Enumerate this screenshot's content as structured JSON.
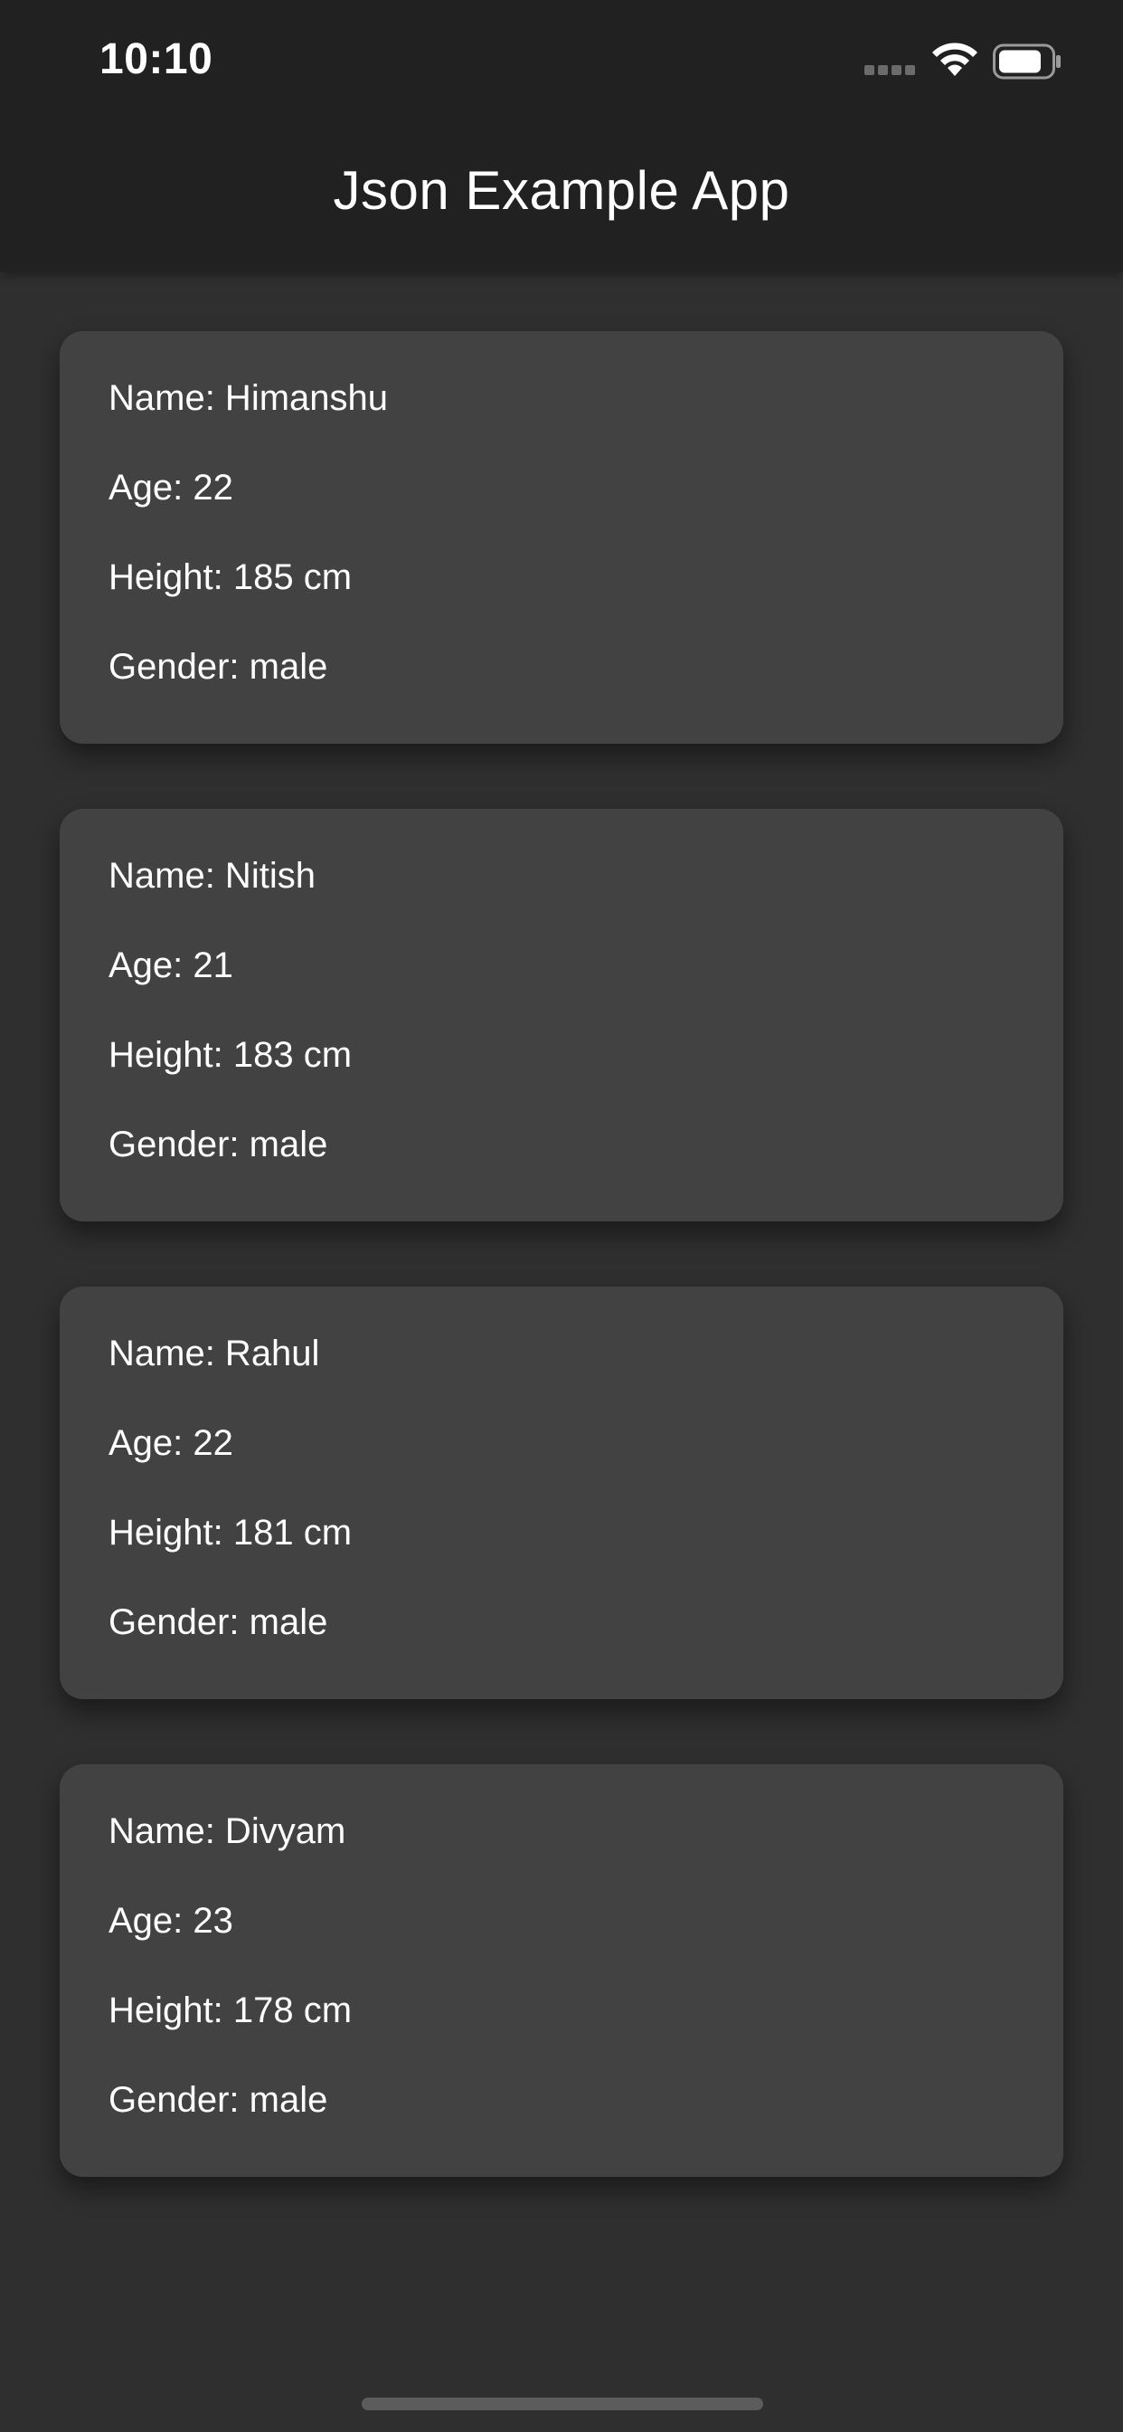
{
  "status_bar": {
    "time": "10:10"
  },
  "app_bar": {
    "title": "Json Example App"
  },
  "people": [
    {
      "name": "Name: Himanshu",
      "age": "Age: 22",
      "height": "Height: 185 cm",
      "gender": "Gender: male"
    },
    {
      "name": "Name: Nitish",
      "age": "Age: 21",
      "height": "Height: 183 cm",
      "gender": "Gender: male"
    },
    {
      "name": "Name: Rahul",
      "age": "Age: 22",
      "height": "Height: 181 cm",
      "gender": "Gender: male"
    },
    {
      "name": "Name: Divyam",
      "age": "Age: 23",
      "height": "Height: 178 cm",
      "gender": "Gender: male"
    }
  ],
  "icons": {
    "signal": "signal-icon",
    "wifi": "wifi-icon",
    "battery": "battery-icon"
  },
  "colors": {
    "background": "#2f2f2f",
    "app_bar": "#212121",
    "card": "#424242",
    "text": "#ffffff"
  }
}
